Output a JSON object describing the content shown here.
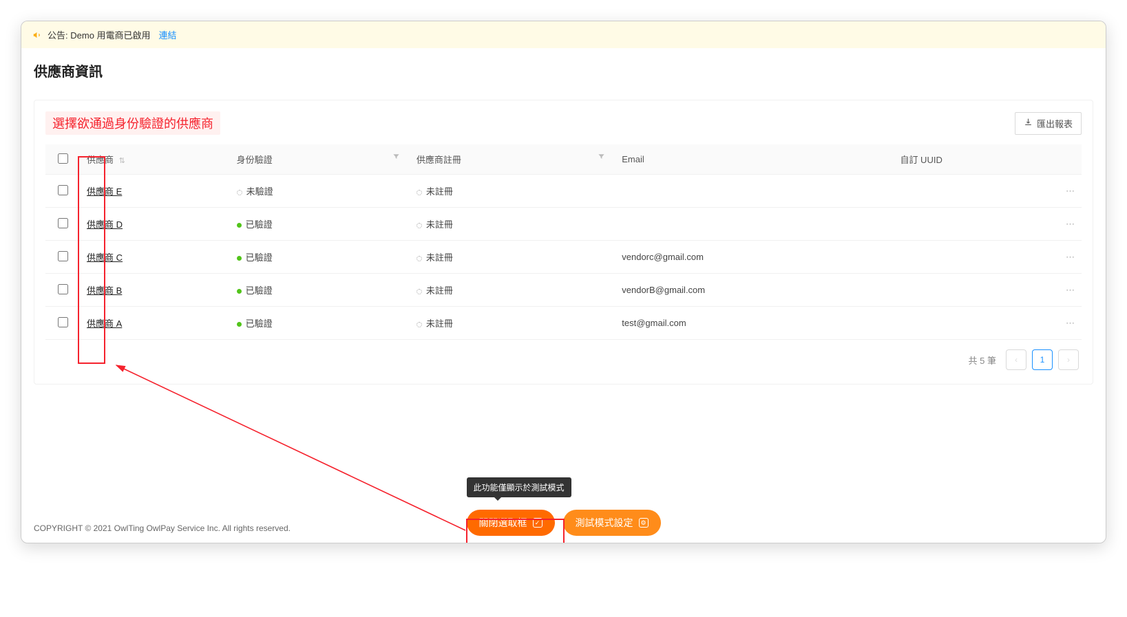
{
  "banner": {
    "prefix": "公告:",
    "message": "Demo 用電商已啟用",
    "link_label": "連結"
  },
  "page": {
    "title": "供應商資訊",
    "hint": "選擇欲通過身份驗證的供應商",
    "export_label": "匯出報表"
  },
  "table": {
    "columns": {
      "vendor": "供應商",
      "identity": "身份驗證",
      "register": "供應商註冊",
      "email": "Email",
      "uuid": "自訂 UUID"
    },
    "rows": [
      {
        "vendor": "供應商 E",
        "identity_status": "unverified",
        "identity_label": "未驗證",
        "register_status": "unregistered",
        "register_label": "未註冊",
        "email": "",
        "uuid": ""
      },
      {
        "vendor": "供應商 D",
        "identity_status": "verified",
        "identity_label": "已驗證",
        "register_status": "unregistered",
        "register_label": "未註冊",
        "email": "",
        "uuid": ""
      },
      {
        "vendor": "供應商 C",
        "identity_status": "verified",
        "identity_label": "已驗證",
        "register_status": "unregistered",
        "register_label": "未註冊",
        "email": "vendorc@gmail.com",
        "uuid": ""
      },
      {
        "vendor": "供應商 B",
        "identity_status": "verified",
        "identity_label": "已驗證",
        "register_status": "unregistered",
        "register_label": "未註冊",
        "email": "vendorB@gmail.com",
        "uuid": ""
      },
      {
        "vendor": "供應商 A",
        "identity_status": "verified",
        "identity_label": "已驗證",
        "register_status": "unregistered",
        "register_label": "未註冊",
        "email": "test@gmail.com",
        "uuid": ""
      }
    ]
  },
  "pagination": {
    "total_label": "共 5 筆",
    "current": "1"
  },
  "footer": {
    "copyright": "COPYRIGHT © 2021 OwlTing OwlPay Service Inc. All rights reserved.",
    "tooltip": "此功能僅顯示於測試模式",
    "close_select_label": "關閉選取框",
    "test_mode_label": "測試模式設定"
  }
}
